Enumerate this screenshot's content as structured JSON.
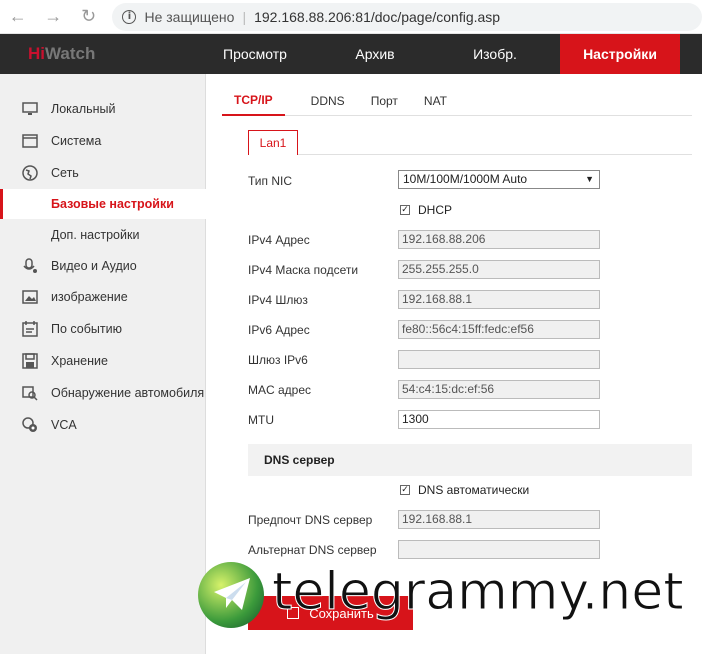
{
  "browser": {
    "security_text": "Не защищено",
    "url": "192.168.88.206:81/doc/page/config.asp"
  },
  "header": {
    "logo_hi": "Hi",
    "logo_watch": "Watch",
    "nav": [
      "Просмотр",
      "Архив",
      "Изобр.",
      "Настройки"
    ],
    "active_nav": "Настройки"
  },
  "sidebar": {
    "items": [
      {
        "label": "Локальный",
        "icon": "monitor-icon"
      },
      {
        "label": "Система",
        "icon": "window-icon"
      },
      {
        "label": "Сеть",
        "icon": "globe-icon"
      },
      {
        "label": "Базовые настройки",
        "icon": ""
      },
      {
        "label": "Доп. настройки",
        "icon": ""
      },
      {
        "label": "Видео и Аудио",
        "icon": "mic-icon"
      },
      {
        "label": "изображение",
        "icon": "image-icon"
      },
      {
        "label": "По событию",
        "icon": "calendar-icon"
      },
      {
        "label": "Хранение",
        "icon": "disk-icon"
      },
      {
        "label": "Обнаружение автомобиля",
        "icon": "car-search-icon"
      },
      {
        "label": "VCA",
        "icon": "vca-icon"
      }
    ],
    "active": "Базовые настройки"
  },
  "tabs": [
    "TCP/IP",
    "DDNS",
    "Порт",
    "NAT"
  ],
  "active_tab": "TCP/IP",
  "subtab": "Lan1",
  "form": {
    "nic_type_label": "Тип NIC",
    "nic_type_value": "10M/100M/1000M Auto",
    "dhcp_label": "DHCP",
    "dhcp_checked": true,
    "ipv4_label": "IPv4 Адрес",
    "ipv4_value": "192.168.88.206",
    "mask_label": "IPv4 Маска подсети",
    "mask_value": "255.255.255.0",
    "gateway_label": "IPv4 Шлюз",
    "gateway_value": "192.168.88.1",
    "ipv6_label": "IPv6 Адрес",
    "ipv6_value": "fe80::56c4:15ff:fedc:ef56",
    "ipv6_gw_label": "Шлюз IPv6",
    "ipv6_gw_value": "",
    "mac_label": "MAC адрес",
    "mac_value": "54:c4:15:dc:ef:56",
    "mtu_label": "MTU",
    "mtu_value": "1300",
    "dns_section": "DNS сервер",
    "dns_auto_label": "DNS автоматически",
    "dns_auto_checked": true,
    "dns_pref_label": "Предпочт DNS сервер",
    "dns_pref_value": "192.168.88.1",
    "dns_alt_label": "Альтернат DNS сервер",
    "dns_alt_value": ""
  },
  "save_label": "Сохранить",
  "watermark": "telegrammy.net",
  "colors": {
    "accent": "#d7141a",
    "topbar": "#2b2b2b",
    "sidebar": "#f0f0f0"
  }
}
